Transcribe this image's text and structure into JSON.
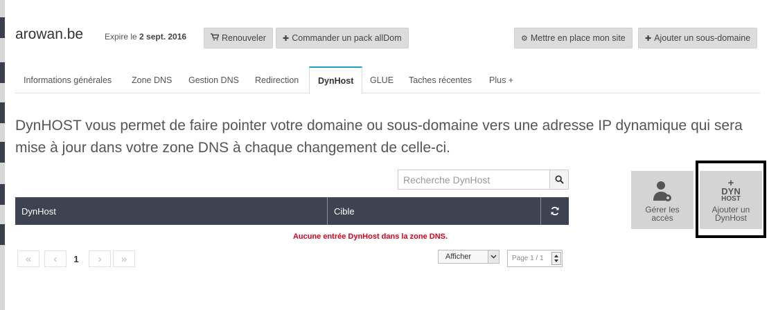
{
  "header": {
    "domain": "arowan.be",
    "expire_prefix": "Expire le",
    "expire_date": "2 sept. 2016",
    "renew_label": "Renouveler",
    "order_pack_label": "Commander un pack allDom",
    "setup_site_label": "Mettre en place mon site",
    "add_subdomain_label": "Ajouter un sous-domaine"
  },
  "tabs": [
    {
      "label": "Informations générales"
    },
    {
      "label": "Zone DNS"
    },
    {
      "label": "Gestion DNS"
    },
    {
      "label": "Redirection"
    },
    {
      "label": "DynHost",
      "active": true
    },
    {
      "label": "GLUE"
    },
    {
      "label": "Taches récentes"
    },
    {
      "label": "Plus +"
    }
  ],
  "description": "DynHOST vous permet de faire pointer votre domaine ou sous-domaine vers une adresse IP dynamique qui sera mise à jour dans votre zone DNS à chaque changement de celle-ci.",
  "search": {
    "placeholder": "Recherche DynHost"
  },
  "table": {
    "columns": [
      "DynHost",
      "Cible"
    ],
    "empty_message": "Aucune entrée DynHost dans la zone DNS."
  },
  "pagination": {
    "current_page": "1",
    "show_select": "Afficher",
    "page_indicator": "Page 1 / 1"
  },
  "actions": {
    "manage_access_line1": "Gérer les",
    "manage_access_line2": "accès",
    "add_dynhost_line1": "Ajouter un",
    "add_dynhost_line2": "DynHost",
    "dynhost_icon_top": "DYN",
    "dynhost_icon_bottom": "HOST"
  },
  "colors": {
    "table_header": "#3e4351",
    "active_tab_accent": "#1aa0c8",
    "error_text": "#d9001b"
  }
}
